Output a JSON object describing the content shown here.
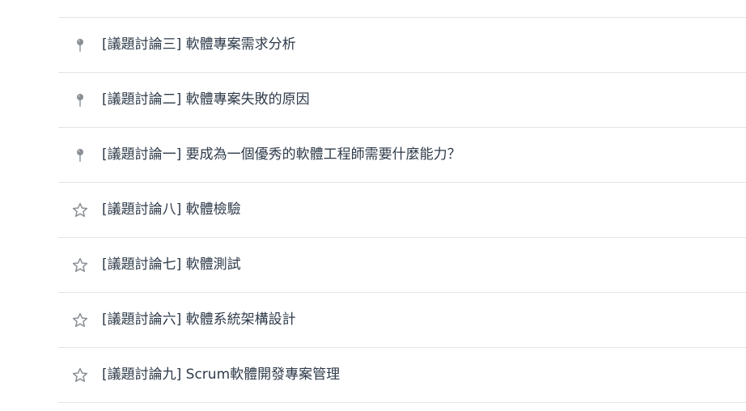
{
  "topics": [
    {
      "icon": "pushpin-icon",
      "title": "[議題討論三] 軟體專案需求分析"
    },
    {
      "icon": "pushpin-icon",
      "title": "[議題討論二] 軟體專案失敗的原因"
    },
    {
      "icon": "pushpin-icon",
      "title": "[議題討論一] 要成為一個優秀的軟體工程師需要什麼能力？"
    },
    {
      "icon": "star-outline-icon",
      "title": "[議題討論八] 軟體檢驗"
    },
    {
      "icon": "star-outline-icon",
      "title": "[議題討論七] 軟體測試"
    },
    {
      "icon": "star-outline-icon",
      "title": "[議題討論六] 軟體系統架構設計"
    },
    {
      "icon": "star-outline-icon",
      "title": "[議題討論九] Scrum軟體開發專案管理"
    }
  ],
  "colors": {
    "text": "#2f3b4a",
    "divider": "#e4e4e4",
    "icon": "#8a8f95"
  }
}
